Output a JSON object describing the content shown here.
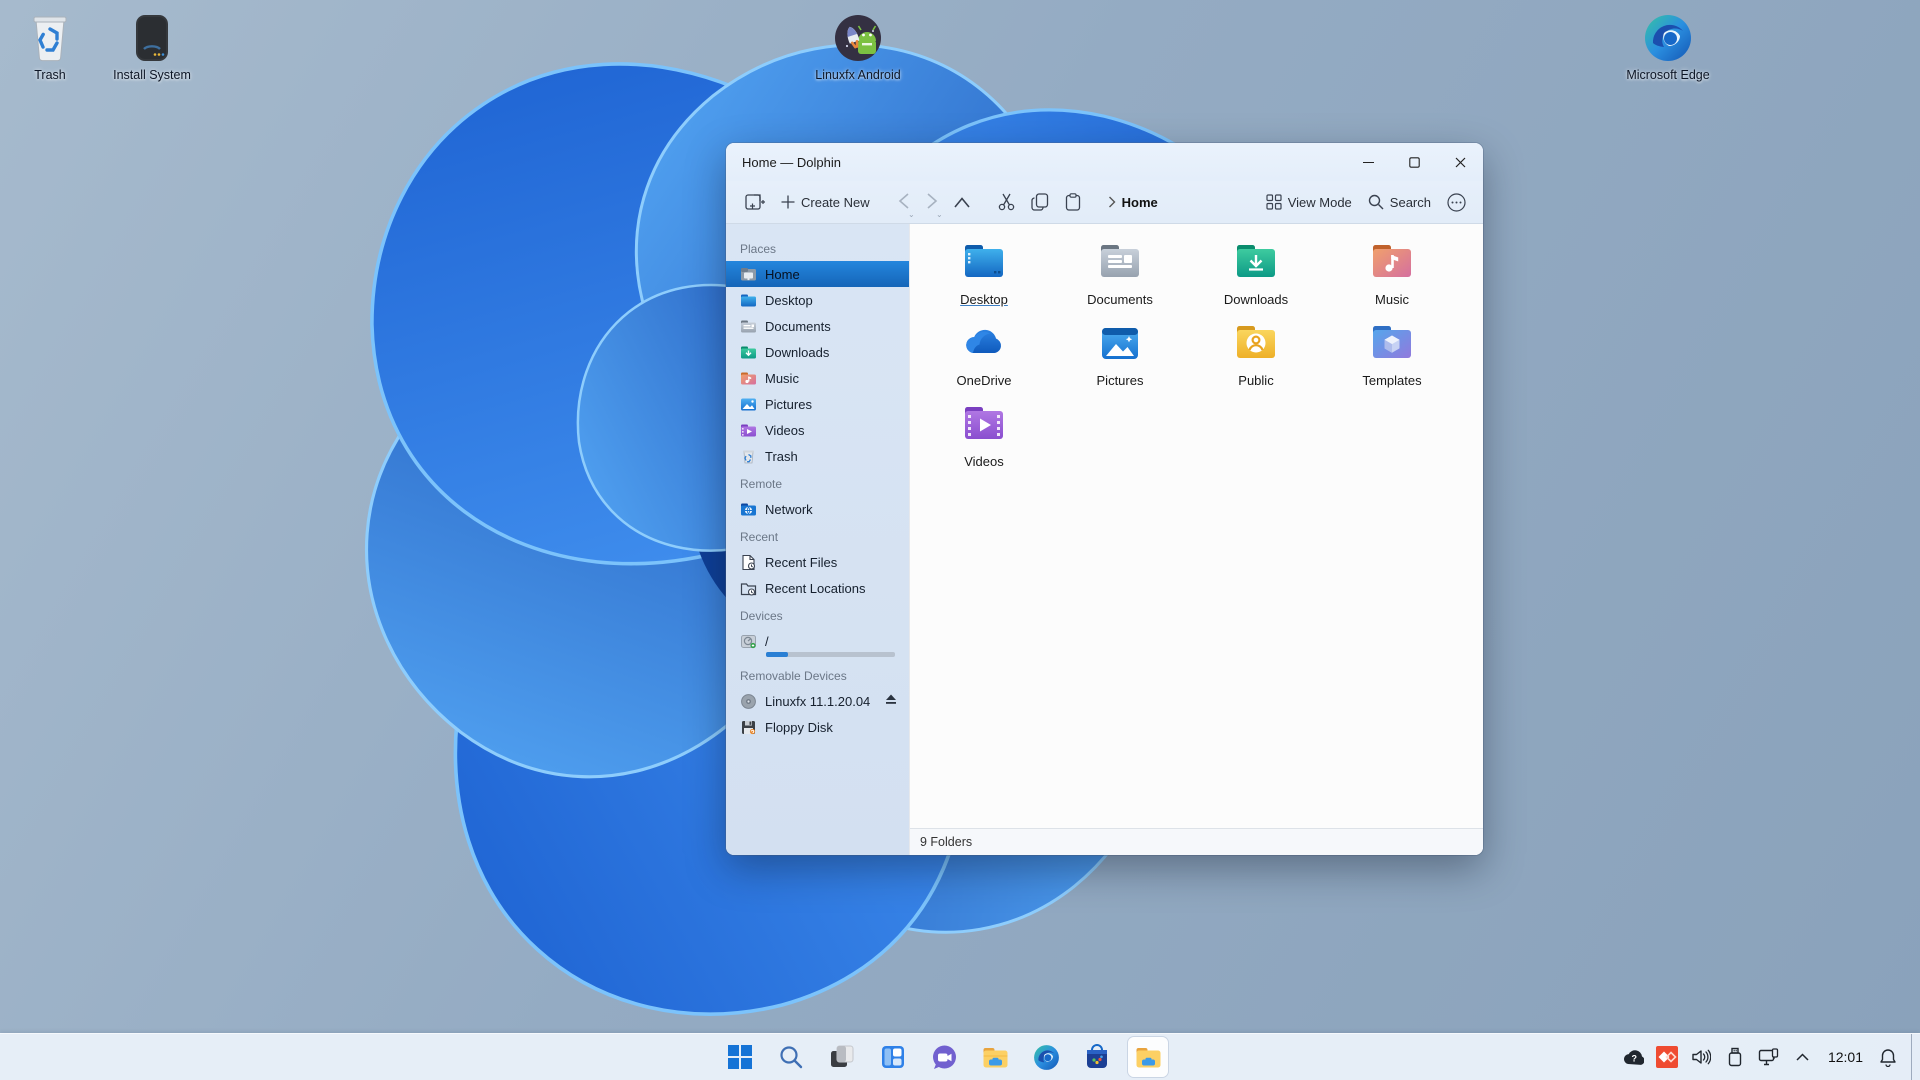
{
  "desktop": {
    "icons": [
      {
        "label": "Trash"
      },
      {
        "label": "Install System"
      },
      {
        "label": "Linuxfx Android"
      },
      {
        "label": "Microsoft Edge"
      }
    ]
  },
  "window": {
    "title": "Home — Dolphin",
    "controls": {
      "minimize": "minimize",
      "maximize": "maximize",
      "close": "close"
    },
    "toolbar": {
      "create_new_label": "Create New",
      "breadcrumb_current": "Home",
      "view_mode_label": "View Mode",
      "search_label": "Search",
      "icons": [
        "new-file",
        "create-new",
        "back",
        "forward",
        "up",
        "cut",
        "copy",
        "paste",
        "view-mode-grid",
        "search",
        "overflow-menu"
      ]
    },
    "sidebar": {
      "sections": [
        {
          "title": "Places",
          "items": [
            "Home",
            "Desktop",
            "Documents",
            "Downloads",
            "Music",
            "Pictures",
            "Videos",
            "Trash"
          ]
        },
        {
          "title": "Remote",
          "items": [
            "Network"
          ]
        },
        {
          "title": "Recent",
          "items": [
            "Recent Files",
            "Recent Locations"
          ]
        },
        {
          "title": "Devices",
          "items": [
            "/"
          ]
        },
        {
          "title": "Removable Devices",
          "items": [
            "Linuxfx 11.1.20.04",
            "Floppy Disk"
          ]
        }
      ],
      "selected_item": "Home",
      "root_usage_percent": 17
    },
    "folders": [
      "Desktop",
      "Documents",
      "Downloads",
      "Music",
      "OneDrive",
      "Pictures",
      "Public",
      "Templates",
      "Videos"
    ],
    "hovered_folder": "Desktop",
    "status": "9 Folders"
  },
  "taskbar": {
    "icons": [
      "start",
      "search",
      "task-view",
      "widgets",
      "chat",
      "file-explorer",
      "edge",
      "store",
      "dolphin"
    ],
    "active_icon": "dolphin",
    "tray_icons": [
      "cloud-sync",
      "anydesk",
      "volume",
      "usb-device",
      "network-display",
      "chevron-up",
      "clock",
      "notifications",
      "show-desktop"
    ],
    "clock": "12:01"
  },
  "colors": {
    "selection_blue": "#1c72c9",
    "window_chrome": "#e8f1fb",
    "sidebar_bg": "#d7e3f2",
    "main_bg": "#fcfcfc",
    "taskbar_bg": "#e9f0f9",
    "anydesk_red": "#ef4b31",
    "wallpaper_blue": "#2e7fe8"
  }
}
